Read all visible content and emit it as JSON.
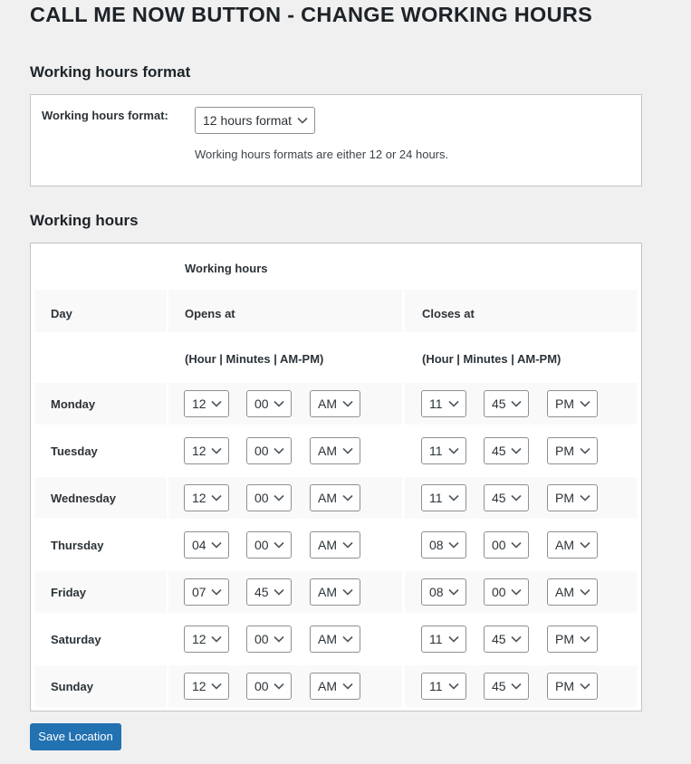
{
  "page": {
    "title": "CALL ME NOW BUTTON - CHANGE WORKING HOURS"
  },
  "format_section": {
    "title": "Working hours format",
    "label": "Working hours format:",
    "selected": "12 hours format",
    "description": "Working hours formats are either 12 or 24 hours."
  },
  "hours_section": {
    "title": "Working hours",
    "header_group": "Working hours",
    "col_day": "Day",
    "col_opens": "Opens at",
    "col_closes": "Closes at",
    "sub_opens": "(Hour | Minutes | AM-PM)",
    "sub_closes": "(Hour | Minutes | AM-PM)",
    "days": [
      {
        "name": "Monday",
        "open_h": "12",
        "open_m": "00",
        "open_ap": "AM",
        "close_h": "11",
        "close_m": "45",
        "close_ap": "PM"
      },
      {
        "name": "Tuesday",
        "open_h": "12",
        "open_m": "00",
        "open_ap": "AM",
        "close_h": "11",
        "close_m": "45",
        "close_ap": "PM"
      },
      {
        "name": "Wednesday",
        "open_h": "12",
        "open_m": "00",
        "open_ap": "AM",
        "close_h": "11",
        "close_m": "45",
        "close_ap": "PM"
      },
      {
        "name": "Thursday",
        "open_h": "04",
        "open_m": "00",
        "open_ap": "AM",
        "close_h": "08",
        "close_m": "00",
        "close_ap": "AM"
      },
      {
        "name": "Friday",
        "open_h": "07",
        "open_m": "45",
        "open_ap": "AM",
        "close_h": "08",
        "close_m": "00",
        "close_ap": "AM"
      },
      {
        "name": "Saturday",
        "open_h": "12",
        "open_m": "00",
        "open_ap": "AM",
        "close_h": "11",
        "close_m": "45",
        "close_ap": "PM"
      },
      {
        "name": "Sunday",
        "open_h": "12",
        "open_m": "00",
        "open_ap": "AM",
        "close_h": "11",
        "close_m": "45",
        "close_ap": "PM"
      }
    ]
  },
  "actions": {
    "save_label": "Save Location"
  },
  "icons": {
    "dropdown": "chevron-down-icon"
  },
  "colors": {
    "primary": "#2271b1",
    "background": "#f0f0f1",
    "panel": "#ffffff"
  }
}
